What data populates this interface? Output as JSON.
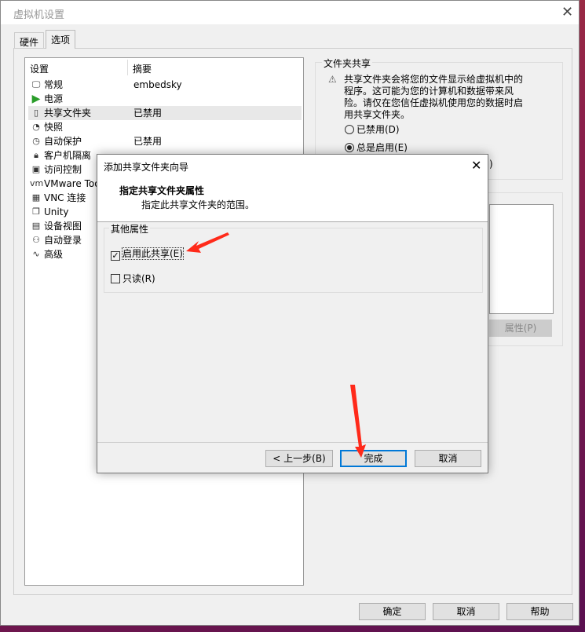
{
  "window": {
    "title": "虚拟机设置",
    "tabs": [
      "硬件",
      "选项"
    ],
    "active_tab": "选项"
  },
  "list": {
    "headers": [
      "设置",
      "摘要"
    ],
    "items": [
      {
        "icon": "monitor-icon",
        "name": "常规",
        "summary": "embedsky"
      },
      {
        "icon": "power-play-icon",
        "name": "电源",
        "summary": ""
      },
      {
        "icon": "shared-folder-icon",
        "name": "共享文件夹",
        "summary": "已禁用",
        "selected": true
      },
      {
        "icon": "snapshot-icon",
        "name": "快照",
        "summary": ""
      },
      {
        "icon": "autoprotect-clock-icon",
        "name": "自动保护",
        "summary": "已禁用"
      },
      {
        "icon": "lock-icon",
        "name": "客户机隔离",
        "summary": ""
      },
      {
        "icon": "access-control-icon",
        "name": "访问控制",
        "summary": ""
      },
      {
        "icon": "vm-icon",
        "name": "VMware Tools",
        "summary": ""
      },
      {
        "icon": "vnc-icon",
        "name": "VNC 连接",
        "summary": ""
      },
      {
        "icon": "unity-icon",
        "name": "Unity",
        "summary": ""
      },
      {
        "icon": "device-view-icon",
        "name": "设备视图",
        "summary": ""
      },
      {
        "icon": "autologin-icon",
        "name": "自动登录",
        "summary": ""
      },
      {
        "icon": "advanced-icon",
        "name": "高级",
        "summary": ""
      }
    ]
  },
  "folder_sharing": {
    "title": "文件夹共享",
    "warning": "共享文件夹会将您的文件显示给虚拟机中的程序。这可能为您的计算机和数据带来风险。请仅在您信任虚拟机使用您的数据时启用共享文件夹。",
    "options": [
      "已禁用(D)",
      "总是启用(E)"
    ],
    "selected": "总是启用(E)",
    "hidden_option_tail": ")"
  },
  "properties_button": "属性(P)",
  "footer": {
    "ok": "确定",
    "cancel": "取消",
    "help": "帮助"
  },
  "dialog": {
    "title": "添加共享文件夹向导",
    "heading": "指定共享文件夹属性",
    "subheading": "指定此共享文件夹的范围。",
    "group": "其他属性",
    "checkboxes": [
      {
        "label": "启用此共享(E)",
        "checked": true
      },
      {
        "label": "只读(R)",
        "checked": false
      }
    ],
    "back": "< 上一步(B)",
    "finish": "完成",
    "cancel": "取消"
  },
  "annotation_color": "#ff2a1a"
}
